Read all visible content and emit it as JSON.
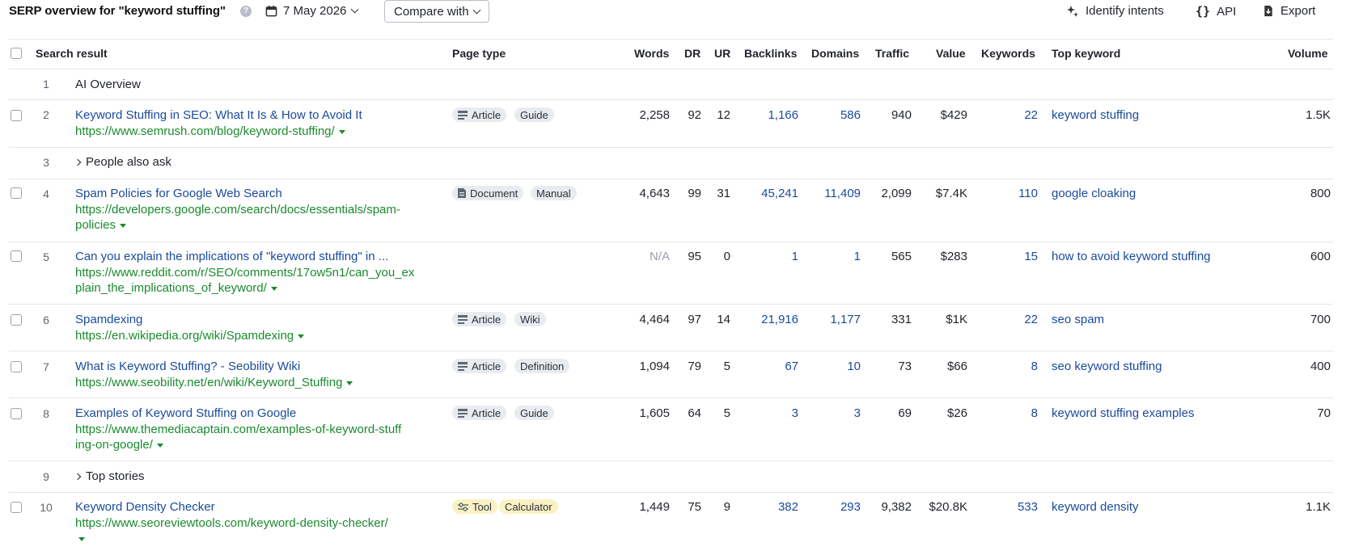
{
  "header": {
    "title": "SERP overview for \"keyword stuffing\"",
    "help": "?",
    "date": "7 May 2026",
    "compare_label": "Compare with",
    "identify_intents": "Identify intents",
    "api": "API",
    "export": "Export"
  },
  "columns": {
    "search_result": "Search result",
    "page_type": "Page type",
    "words": "Words",
    "dr": "DR",
    "ur": "UR",
    "backlinks": "Backlinks",
    "domains": "Domains",
    "traffic": "Traffic",
    "value": "Value",
    "keywords": "Keywords",
    "top_keyword": "Top keyword",
    "volume": "Volume"
  },
  "rows": [
    {
      "pos": "1",
      "feature": "AI Overview"
    },
    {
      "pos": "2",
      "title": "Keyword Stuffing in SEO: What It Is & How to Avoid It",
      "url": "https://www.semrush.com/blog/keyword-stuffing/",
      "types": [
        "Article",
        "Guide"
      ],
      "type_icon": "article-icon",
      "words": "2,258",
      "dr": "92",
      "ur": "12",
      "backlinks": "1,166",
      "domains": "586",
      "traffic": "940",
      "value": "$429",
      "keywords": "22",
      "top_keyword": "keyword stuffing",
      "volume": "1.5K"
    },
    {
      "pos": "3",
      "feature": "People also ask"
    },
    {
      "pos": "4",
      "title": "Spam Policies for Google Web Search",
      "url": "https://developers.google.com/search/docs/essentials/spam-policies",
      "types": [
        "Document",
        "Manual"
      ],
      "type_icon": "document-icon",
      "words": "4,643",
      "dr": "99",
      "ur": "31",
      "backlinks": "45,241",
      "domains": "11,409",
      "traffic": "2,099",
      "value": "$7.4K",
      "keywords": "110",
      "top_keyword": "google cloaking",
      "volume": "800"
    },
    {
      "pos": "5",
      "title": "Can you explain the implications of \"keyword stuffing\" in ...",
      "url": "https://www.reddit.com/r/SEO/comments/17ow5n1/can_you_explain_the_implications_of_keyword/",
      "types": [],
      "words": "N/A",
      "dr": "95",
      "ur": "0",
      "backlinks": "1",
      "domains": "1",
      "traffic": "565",
      "value": "$283",
      "keywords": "15",
      "top_keyword": "how to avoid keyword stuffing",
      "volume": "600"
    },
    {
      "pos": "6",
      "title": "Spamdexing",
      "url": "https://en.wikipedia.org/wiki/Spamdexing",
      "types": [
        "Article",
        "Wiki"
      ],
      "type_icon": "article-icon",
      "words": "4,464",
      "dr": "97",
      "ur": "14",
      "backlinks": "21,916",
      "domains": "1,177",
      "traffic": "331",
      "value": "$1K",
      "keywords": "22",
      "top_keyword": "seo spam",
      "volume": "700"
    },
    {
      "pos": "7",
      "title": "What is Keyword Stuffing? - Seobility Wiki",
      "url": "https://www.seobility.net/en/wiki/Keyword_Stuffing",
      "types": [
        "Article",
        "Definition"
      ],
      "type_icon": "article-icon",
      "words": "1,094",
      "dr": "79",
      "ur": "5",
      "backlinks": "67",
      "domains": "10",
      "traffic": "73",
      "value": "$66",
      "keywords": "8",
      "top_keyword": "seo keyword stuffing",
      "volume": "400"
    },
    {
      "pos": "8",
      "title": "Examples of Keyword Stuffing on Google",
      "url": "https://www.themediacaptain.com/examples-of-keyword-stuffing-on-google/",
      "types": [
        "Article",
        "Guide"
      ],
      "type_icon": "article-icon",
      "words": "1,605",
      "dr": "64",
      "ur": "5",
      "backlinks": "3",
      "domains": "3",
      "traffic": "69",
      "value": "$26",
      "keywords": "8",
      "top_keyword": "keyword stuffing examples",
      "volume": "70"
    },
    {
      "pos": "9",
      "feature": "Top stories"
    },
    {
      "pos": "10",
      "title": "Keyword Density Checker",
      "url": "https://www.seoreviewtools.com/keyword-density-checker/",
      "types": [
        "Tool",
        "Calculator"
      ],
      "type_icon": "tool-icon",
      "words": "1,449",
      "dr": "75",
      "ur": "9",
      "backlinks": "382",
      "domains": "293",
      "traffic": "9,382",
      "value": "$20.8K",
      "keywords": "533",
      "top_keyword": "keyword density",
      "volume": "1.1K"
    }
  ]
}
